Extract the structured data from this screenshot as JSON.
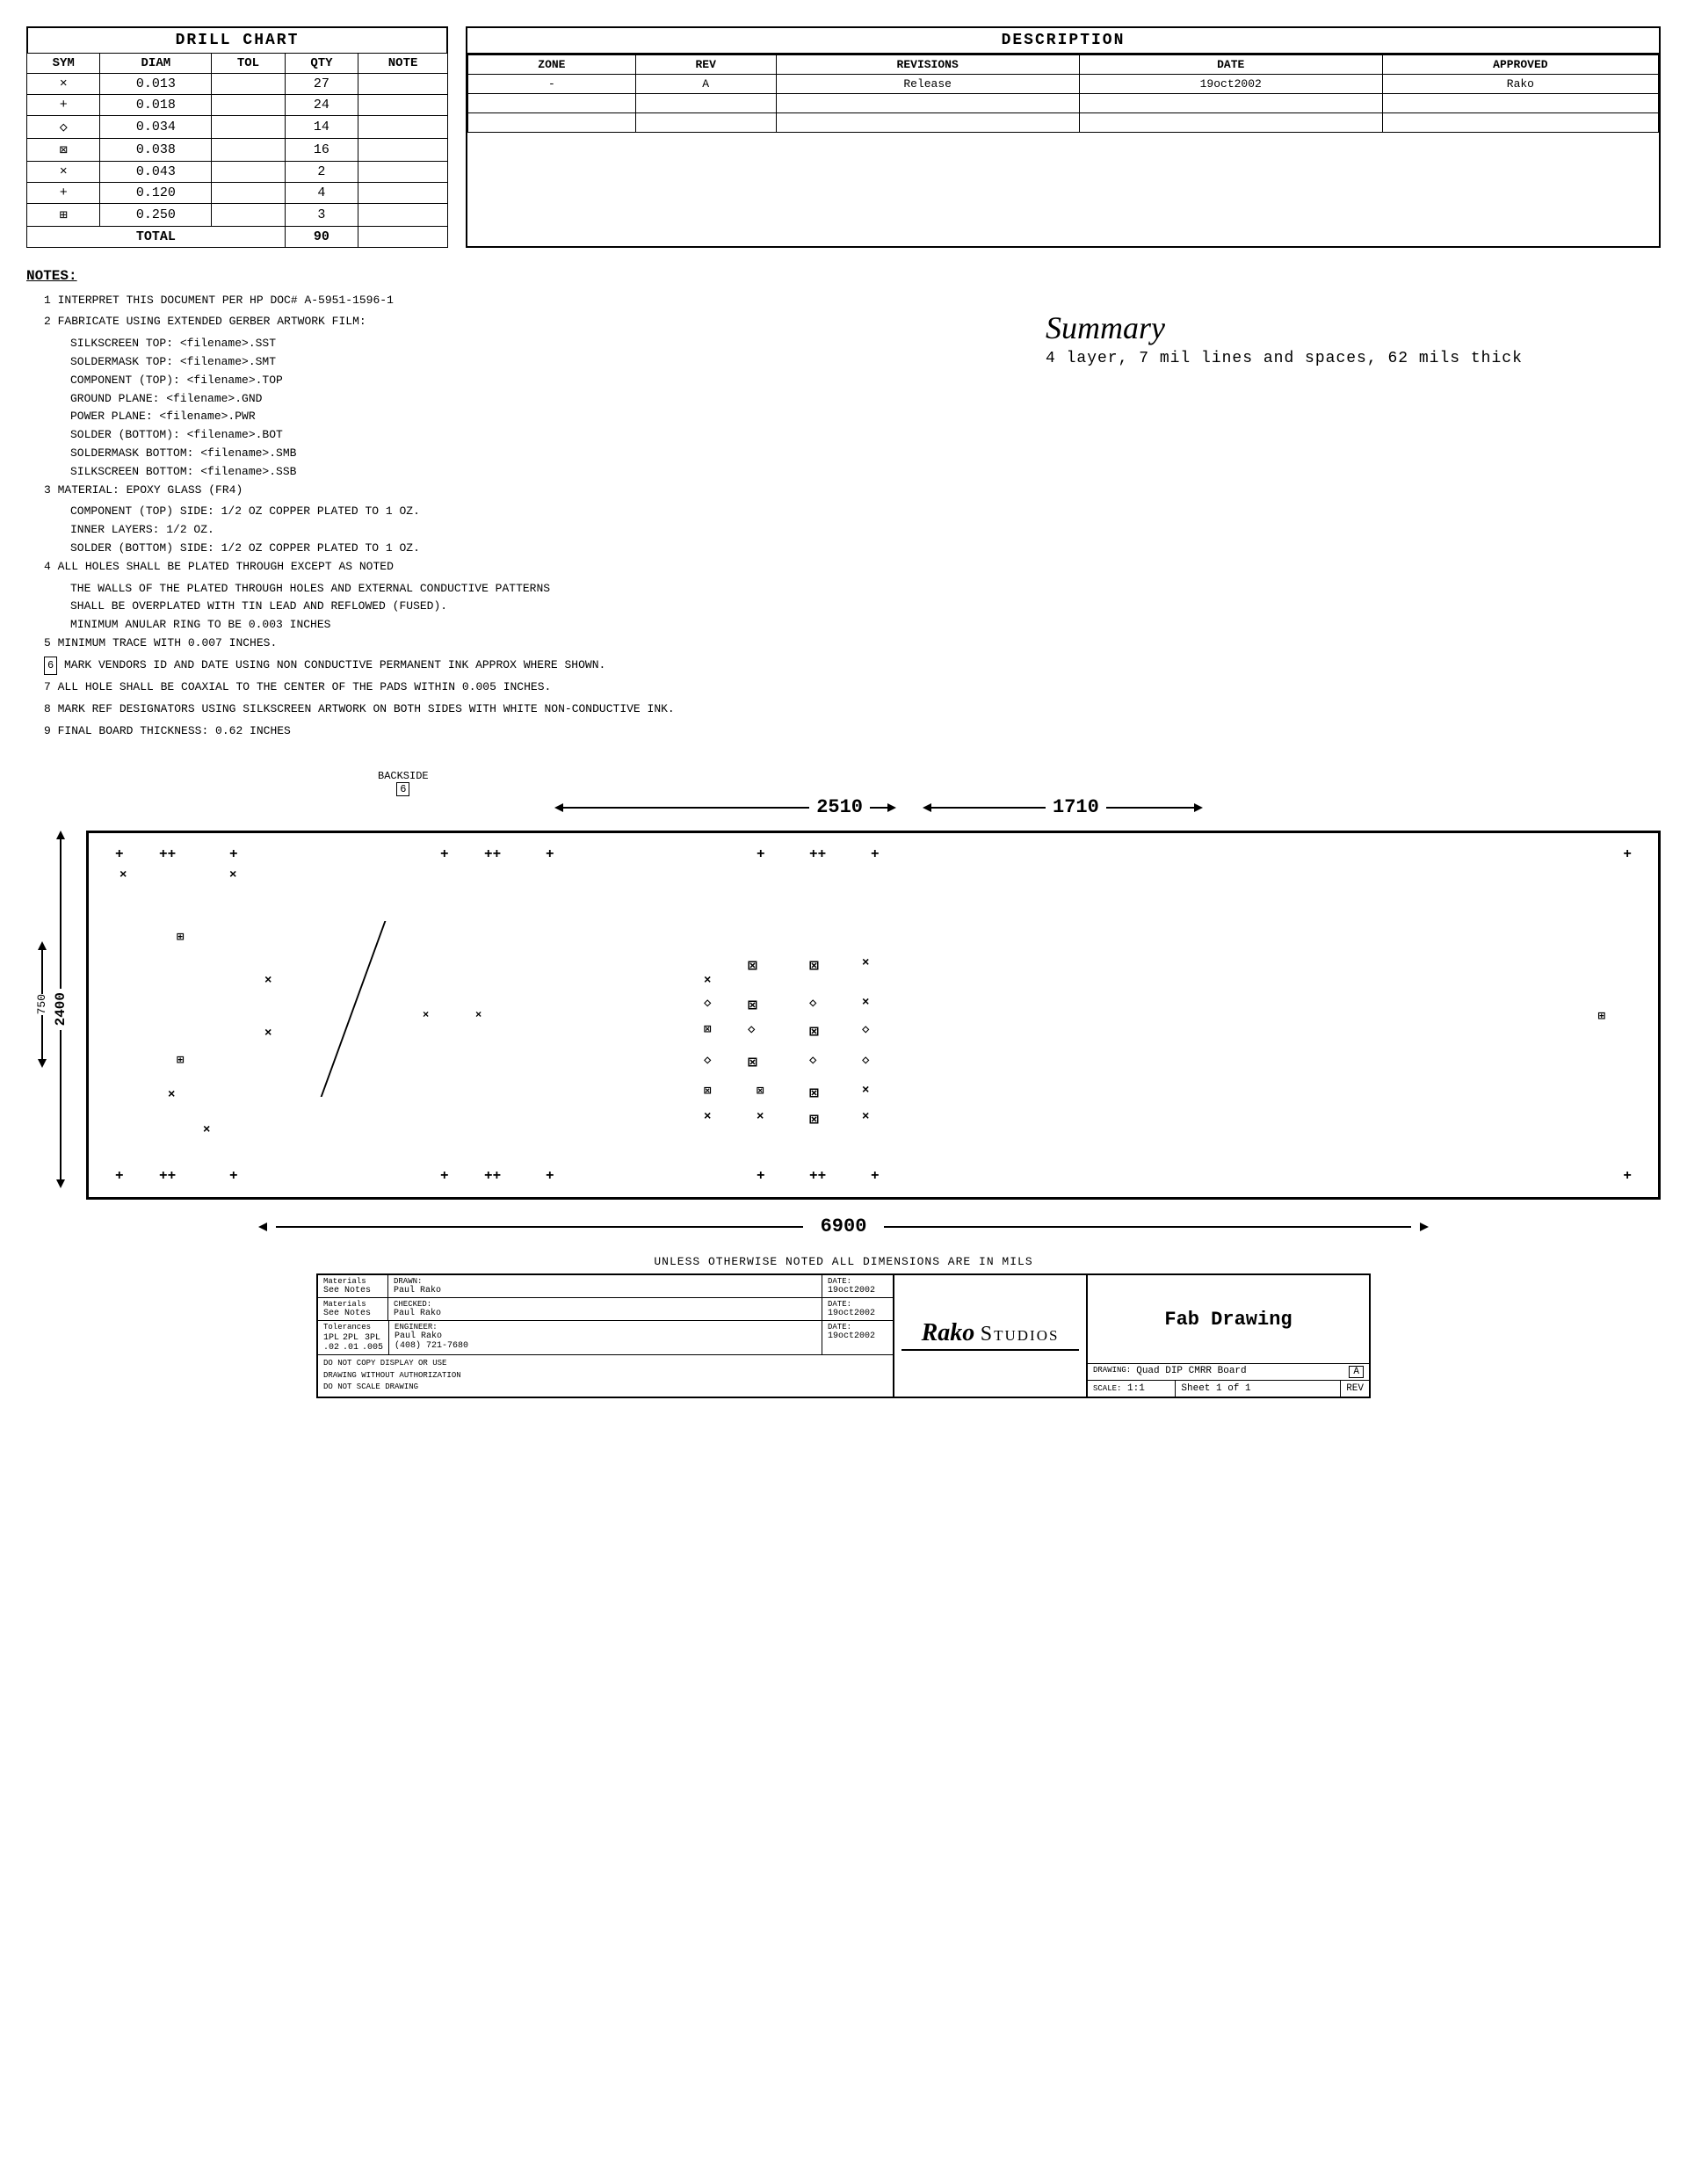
{
  "drillChart": {
    "title": "DRILL CHART",
    "headers": [
      "SYM",
      "DIAM",
      "TOL",
      "QTY",
      "NOTE"
    ],
    "rows": [
      {
        "sym": "×",
        "diam": "0.013",
        "tol": "",
        "qty": "27",
        "note": ""
      },
      {
        "sym": "+",
        "diam": "0.018",
        "tol": "",
        "qty": "24",
        "note": ""
      },
      {
        "sym": "◇",
        "diam": "0.034",
        "tol": "",
        "qty": "14",
        "note": ""
      },
      {
        "sym": "⊠",
        "diam": "0.038",
        "tol": "",
        "qty": "16",
        "note": ""
      },
      {
        "sym": "×",
        "diam": "0.043",
        "tol": "",
        "qty": "2",
        "note": ""
      },
      {
        "sym": "+",
        "diam": "0.120",
        "tol": "",
        "qty": "4",
        "note": ""
      },
      {
        "sym": "⊞",
        "diam": "0.250",
        "tol": "",
        "qty": "3",
        "note": ""
      }
    ],
    "totalLabel": "TOTAL",
    "totalQty": "90"
  },
  "description": {
    "title": "DESCRIPTION",
    "tableHeaders": [
      "ZONE",
      "REV",
      "REVISIONS",
      "DATE",
      "APPROVED"
    ],
    "revisionRow": {
      "zone": "-",
      "rev": "A",
      "revision": "Release",
      "date": "19oct2002",
      "approved": "Rako"
    }
  },
  "notes": {
    "title": "NOTES:",
    "items": [
      {
        "num": "1",
        "text": "INTERPRET THIS DOCUMENT PER HP DOC# A-5951-1596-1"
      },
      {
        "num": "2",
        "text": "FABRICATE USING EXTENDED GERBER ARTWORK FILM:",
        "subs": [
          "SILKSCREEN TOP: <filename>.SST",
          "SOLDERMASK TOP: <filename>.SMT",
          "COMPONENT (TOP): <filename>.TOP",
          "GROUND PLANE: <filename>.GND",
          "POWER PLANE: <filename>.PWR",
          "SOLDER (BOTTOM): <filename>.BOT",
          "SOLDERMASK BOTTOM: <filename>.SMB",
          "SILKSCREEN BOTTOM: <filename>.SSB"
        ]
      },
      {
        "num": "3",
        "text": "MATERIAL: EPOXY GLASS (FR4)",
        "subs": [
          "COMPONENT (TOP) SIDE: 1/2 OZ COPPER PLATED TO 1 OZ.",
          "INNER LAYERS: 1/2 OZ.",
          "SOLDER (BOTTOM) SIDE: 1/2 OZ COPPER PLATED TO 1 OZ."
        ]
      },
      {
        "num": "4",
        "text": "ALL HOLES SHALL BE PLATED THROUGH EXCEPT AS NOTED",
        "subs": [
          "THE WALLS OF THE PLATED THROUGH HOLES AND EXTERNAL CONDUCTIVE PATTERNS",
          "SHALL BE OVERPLATED WITH TIN LEAD AND REFLOWED  (FUSED).",
          "MINIMUM ANULAR RING TO BE 0.003 INCHES"
        ]
      },
      {
        "num": "5",
        "text": "MINIMUM TRACE WITH 0.007 INCHES."
      },
      {
        "num": "6",
        "text": "MARK VENDORS ID AND DATE USING NON CONDUCTIVE PERMANENT INK APPROX WHERE SHOWN.",
        "boxed": true
      },
      {
        "num": "7",
        "text": "ALL HOLE SHALL BE COAXIAL TO THE CENTER OF THE PADS WITHIN 0.005 INCHES."
      },
      {
        "num": "8",
        "text": "MARK REF DESIGNATORS USING SILKSCREEN ARTWORK ON BOTH SIDES WITH WHITE NON-CONDUCTIVE INK."
      },
      {
        "num": "9",
        "text": "FINAL BOARD THICKNESS: 0.62 INCHES"
      }
    ]
  },
  "summary": {
    "title": "Summary",
    "description": "4 layer, 7 mil lines and spaces, 62 mils thick"
  },
  "boardDimensions": {
    "backside": "BACKSIDE",
    "backsideNum": "6",
    "dim1": "2510",
    "dim2": "1710",
    "boardWidth": "2400",
    "boardHeight": "750",
    "totalWidth": "6900"
  },
  "titleBlock": {
    "materialsLabel": "Materials",
    "materialsSub": "See Notes",
    "tolerancesLabel": "Tolerances",
    "tol1": "1PL",
    "tol2": "2PL",
    "tol3": "3PL",
    "tolVal1": ".02",
    "tolVal2": ".01",
    "tolVal3": ".005",
    "drawnLabel": "DRAWN:",
    "drawnName": "Paul  Rako",
    "drawnDate": "19oct2002",
    "checkedLabel": "CHECKED:",
    "checkedName": "Paul  Rako",
    "checkedDate": "19oct2002",
    "engineerLabel": "ENGINEER:",
    "engineerName": "Paul Rako",
    "engineerDate": "19oct2002",
    "engineerPhone": "(408) 721-7680",
    "copyNote1": "DO NOT COPY DISPLAY OR USE",
    "copyNote2": "DRAWING WITHOUT AUTHORIZATION",
    "copyNote3": "DO NOT SCALE DRAWING",
    "logoTop": "Rako",
    "logoBottom": "Studios",
    "drawingTitle": "Fab  Drawing",
    "drawingLabel": "DRAWING:",
    "drawingName": "Quad DIP CMRR Board",
    "revLabel": "A",
    "scaleLabel": "SCALE:",
    "scaleValue": "1:1",
    "sheetLabel": "Sheet 1 of 1",
    "revColLabel": "REV"
  },
  "dimNote": "UNLESS OTHERWISE NOTED ALL DIMENSIONS ARE IN MILS"
}
